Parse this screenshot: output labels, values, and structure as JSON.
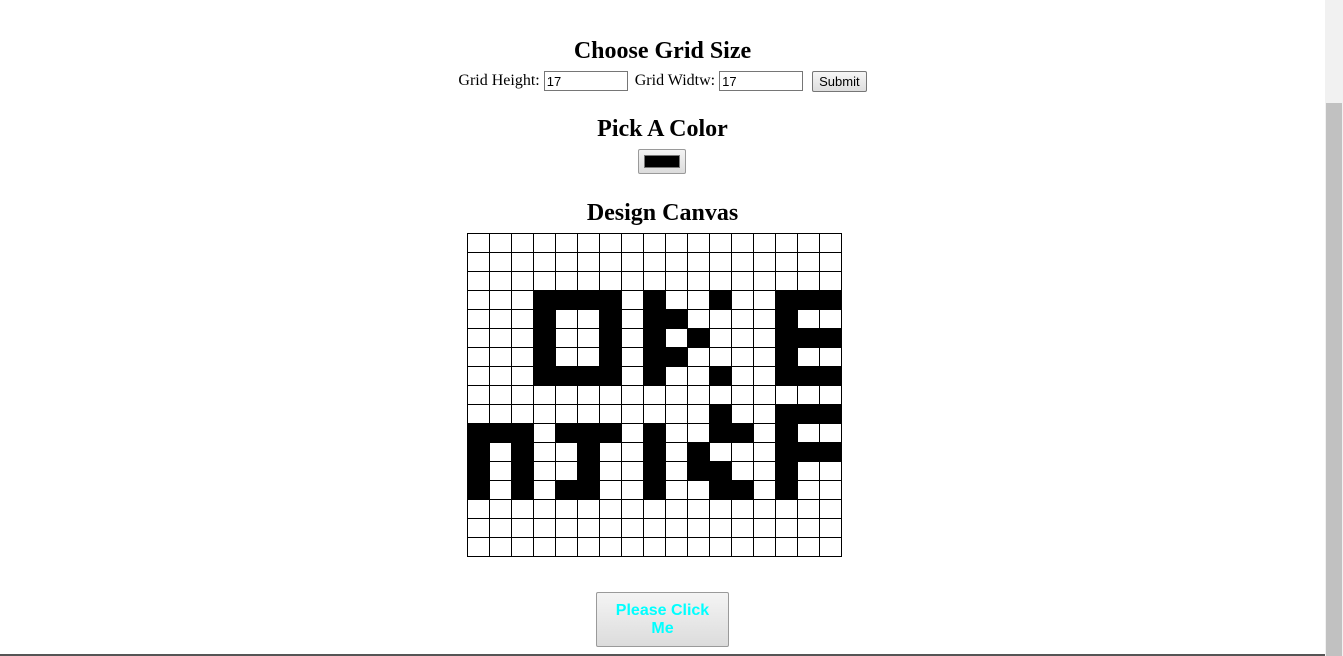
{
  "grid_size": {
    "title": "Choose Grid Size",
    "height_label": "Grid Height:",
    "height_value": "17",
    "width_label": "Grid Widtw:",
    "width_value": "17",
    "submit_label": "Submit"
  },
  "color_picker": {
    "title": "Pick A Color",
    "selected_color": "#000000"
  },
  "canvas": {
    "title": "Design Canvas",
    "rows": 17,
    "cols": 17,
    "cells": [
      "00000000000000000",
      "00000000000000000",
      "00000000000000000",
      "00011110100100111",
      "00010010110000100",
      "00010010101000111",
      "00010010110000100",
      "00011110100100111",
      "00000000000000000",
      "00000000000100111",
      "11101110100110100",
      "10100100101000111",
      "10100100101100100",
      "10101100100110100",
      "00000000000000000",
      "00000000000000000",
      "00000000000000000"
    ]
  },
  "action_button": {
    "label": "Please Click Me",
    "text_color": "#00ffff"
  }
}
